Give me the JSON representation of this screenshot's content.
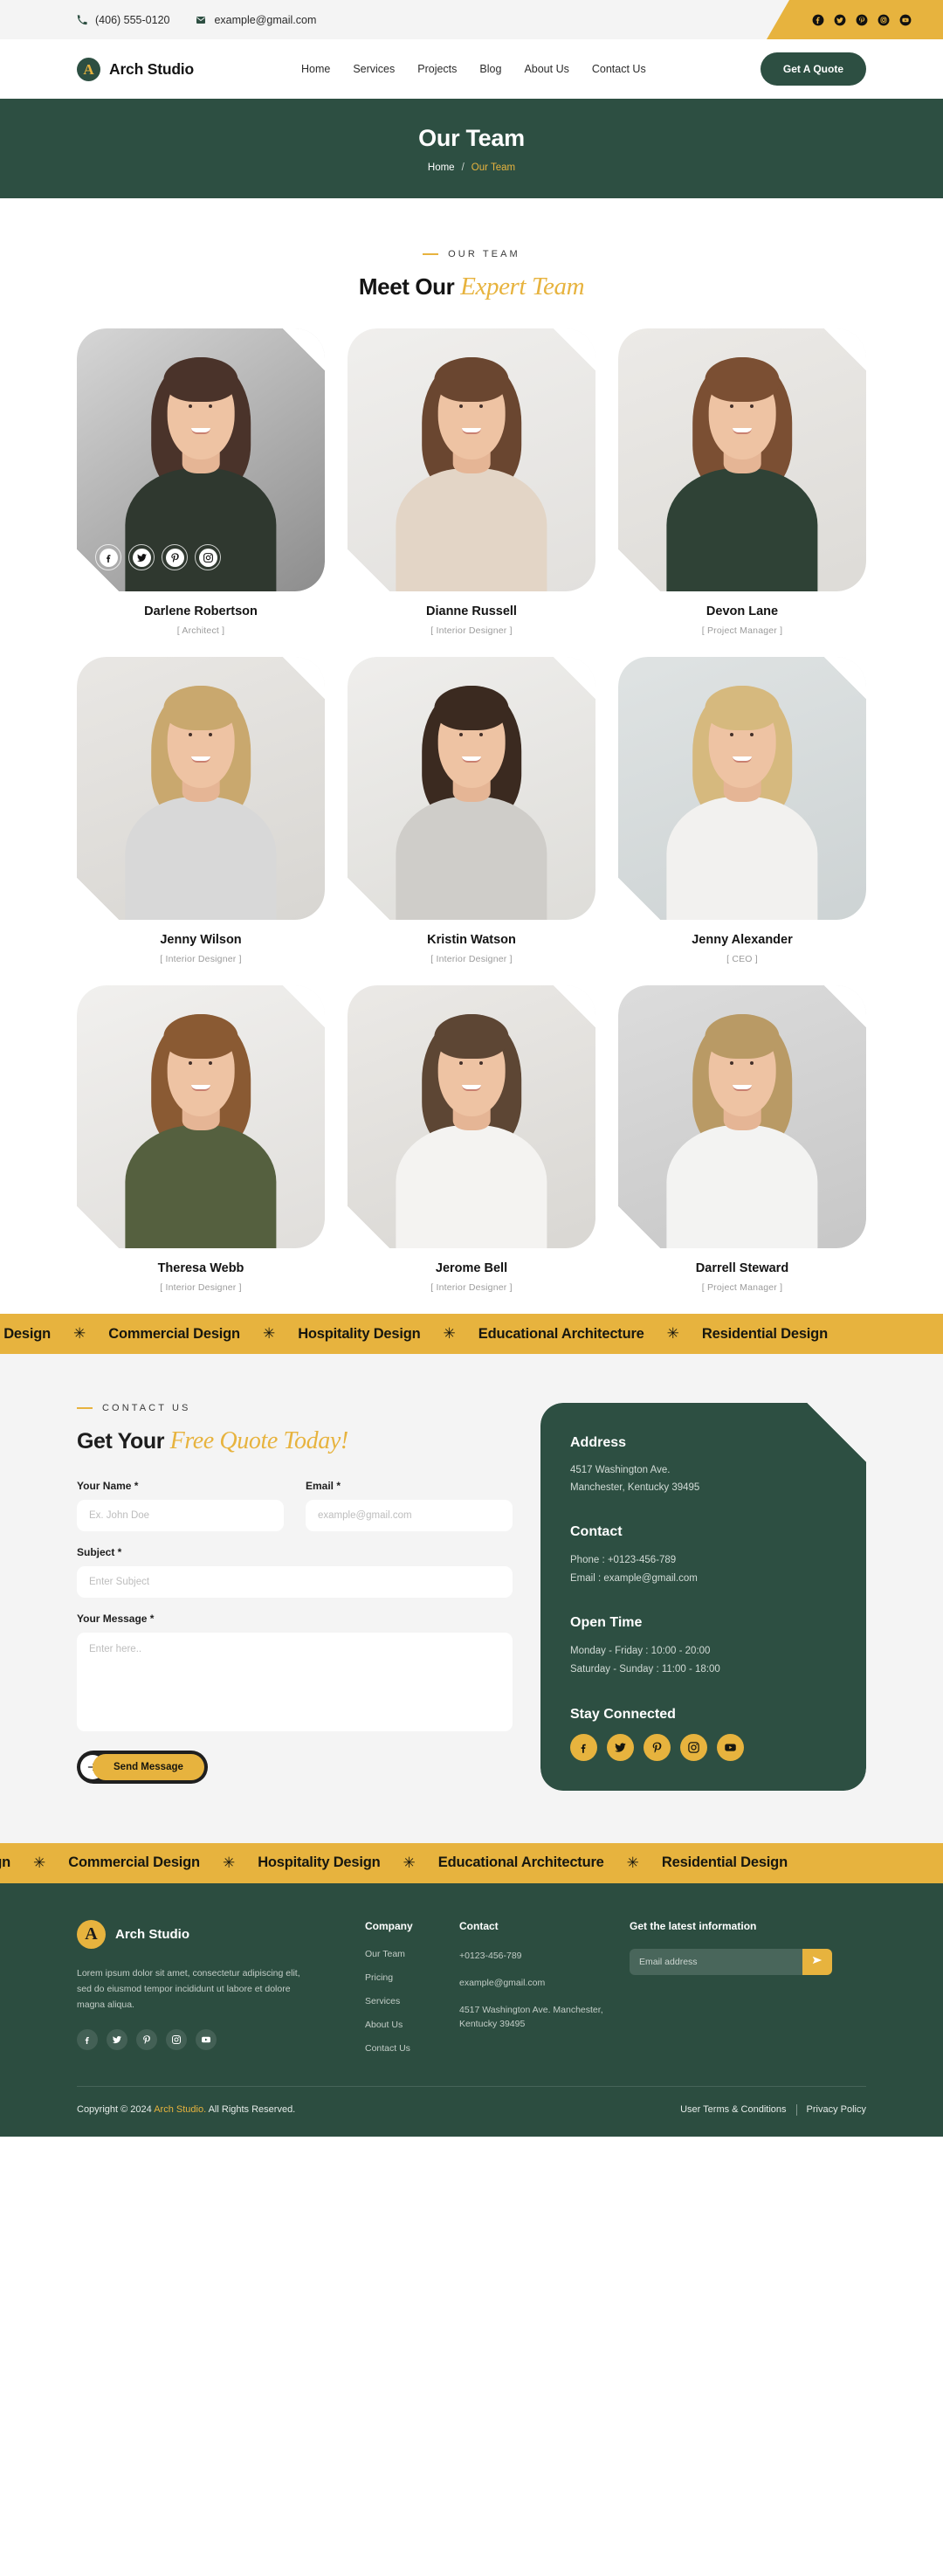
{
  "topbar": {
    "phone": "(406) 555-0120",
    "email": "example@gmail.com",
    "socials": [
      "facebook-icon",
      "twitter-icon",
      "pinterest-icon",
      "instagram-icon",
      "youtube-icon"
    ]
  },
  "nav": {
    "logo_letter": "A",
    "brand": "Arch Studio",
    "menu": [
      "Home",
      "Services",
      "Projects",
      "Blog",
      "About Us",
      "Contact Us"
    ],
    "cta": "Get A Quote"
  },
  "hero": {
    "title": "Our Team",
    "crumb_home": "Home",
    "crumb_sep": "/",
    "crumb_current": "Our Team"
  },
  "team": {
    "eyebrow": "OUR TEAM",
    "title_plain": "Meet Our ",
    "title_italic": "Expert Team",
    "members": [
      {
        "name": "Darlene Robertson",
        "role": "[ Architect ]"
      },
      {
        "name": "Dianne Russell",
        "role": "[ Interior Designer ]"
      },
      {
        "name": "Devon Lane",
        "role": "[ Project Manager ]"
      },
      {
        "name": "Jenny Wilson",
        "role": "[ Interior Designer ]"
      },
      {
        "name": "Kristin Watson",
        "role": "[ Interior Designer ]"
      },
      {
        "name": "Jenny Alexander",
        "role": "[ CEO ]"
      },
      {
        "name": "Theresa Webb",
        "role": "[ Interior Designer ]"
      },
      {
        "name": "Jerome Bell",
        "role": "[ Interior Designer ]"
      },
      {
        "name": "Darrell Steward",
        "role": "[ Project Manager ]"
      }
    ],
    "card_socials": [
      "facebook-icon",
      "twitter-icon",
      "pinterest-icon",
      "instagram-icon"
    ]
  },
  "marquee": {
    "items": [
      "Residential Design",
      "Commercial Design",
      "Hospitality Design",
      "Educational Architecture"
    ],
    "separator": "✳"
  },
  "contact": {
    "eyebrow": "CONTACT US",
    "title_plain": "Get Your ",
    "title_italic": "Free Quote Today!",
    "fields": {
      "name_label": "Your Name *",
      "name_placeholder": "Ex. John Doe",
      "email_label": "Email *",
      "email_placeholder": "example@gmail.com",
      "subject_label": "Subject *",
      "subject_placeholder": "Enter Subject",
      "message_label": "Your Message *",
      "message_placeholder": "Enter here.."
    },
    "submit": "Send Message",
    "info": {
      "address_title": "Address",
      "address_line1": "4517 Washington Ave.",
      "address_line2": "Manchester, Kentucky 39495",
      "contact_title": "Contact",
      "phone": "Phone : +0123-456-789",
      "email": "Email  : example@gmail.com",
      "open_title": "Open Time",
      "open_weekday": "Monday - Friday    : 10:00 - 20:00",
      "open_weekend": "Saturday - Sunday : 11:00 - 18:00",
      "stay_title": "Stay Connected",
      "socials": [
        "facebook-icon",
        "twitter-icon",
        "pinterest-icon",
        "instagram-icon",
        "youtube-icon"
      ]
    }
  },
  "footer": {
    "logo_letter": "A",
    "brand": "Arch Studio",
    "description": "Lorem ipsum dolor sit amet, consectetur adipiscing elit, sed do eiusmod tempor incididunt ut labore et dolore magna aliqua.",
    "socials": [
      "facebook-icon",
      "twitter-icon",
      "pinterest-icon",
      "instagram-icon",
      "youtube-icon"
    ],
    "company_title": "Company",
    "company_links": [
      "Our Team",
      "Pricing",
      "Services",
      "About Us",
      "Contact Us"
    ],
    "contact_title": "Contact",
    "contact_phone": "+0123-456-789",
    "contact_email": "example@gmail.com",
    "contact_address": "4517 Washington Ave. Manchester, Kentucky 39495",
    "news_title": "Get the latest information",
    "news_placeholder": "Email address",
    "copyright_pre": "Copyright © 2024 ",
    "copyright_brand": "Arch Studio.",
    "copyright_post": " All Rights Reserved.",
    "terms": "User Terms & Conditions",
    "privacy": "Privacy Policy"
  },
  "colors": {
    "green": "#2d4f42",
    "gold": "#e7b33e",
    "ink": "#1d1d1d",
    "light": "#f4f4f4"
  }
}
